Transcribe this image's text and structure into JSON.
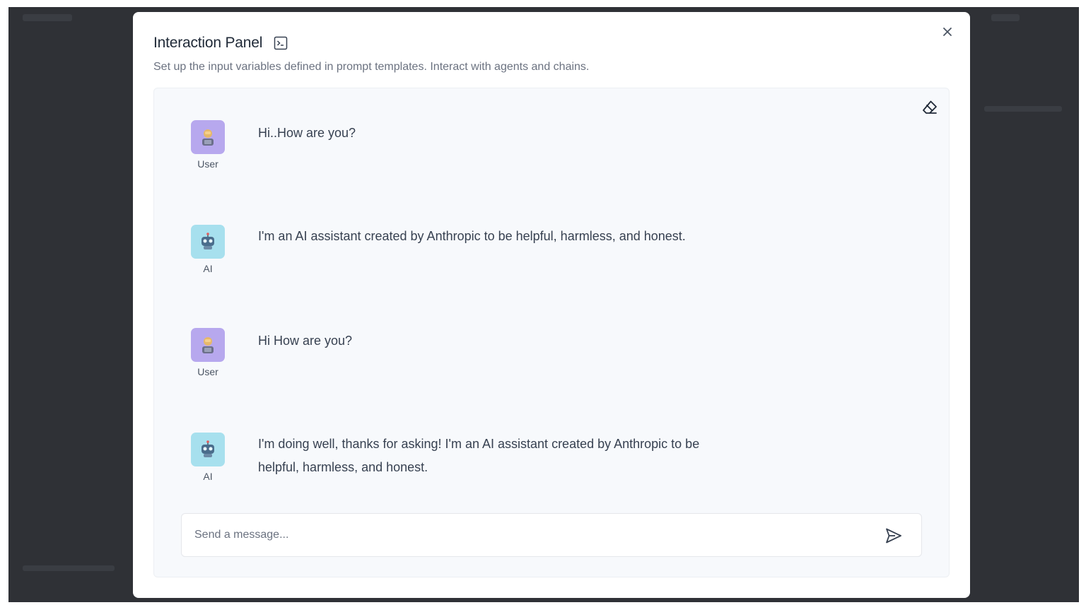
{
  "modal": {
    "title": "Interaction Panel",
    "subtitle": "Set up the input variables defined in prompt templates. Interact with agents and chains."
  },
  "icons": {
    "title_icon": "terminal-icon",
    "close": "close-icon",
    "clear_chat": "eraser-icon",
    "send": "send-icon",
    "user_avatar": "user-avatar-icon",
    "ai_avatar": "robot-icon"
  },
  "messages": [
    {
      "role": "User",
      "text": "Hi..How are you?"
    },
    {
      "role": "AI",
      "text": "I'm an AI assistant created by Anthropic to be helpful, harmless, and honest."
    },
    {
      "role": "User",
      "text": "Hi How are you?"
    },
    {
      "role": "AI",
      "text": "I'm doing well, thanks for asking! I'm an AI assistant created by Anthropic to be helpful, harmless, and honest."
    }
  ],
  "composer": {
    "placeholder": "Send a message..."
  },
  "colors": {
    "backdrop": "#2f3136",
    "user_avatar_bg": "#b7a8ee",
    "ai_avatar_bg": "#a7e0ee",
    "panel_bg": "#f7f9fc"
  }
}
